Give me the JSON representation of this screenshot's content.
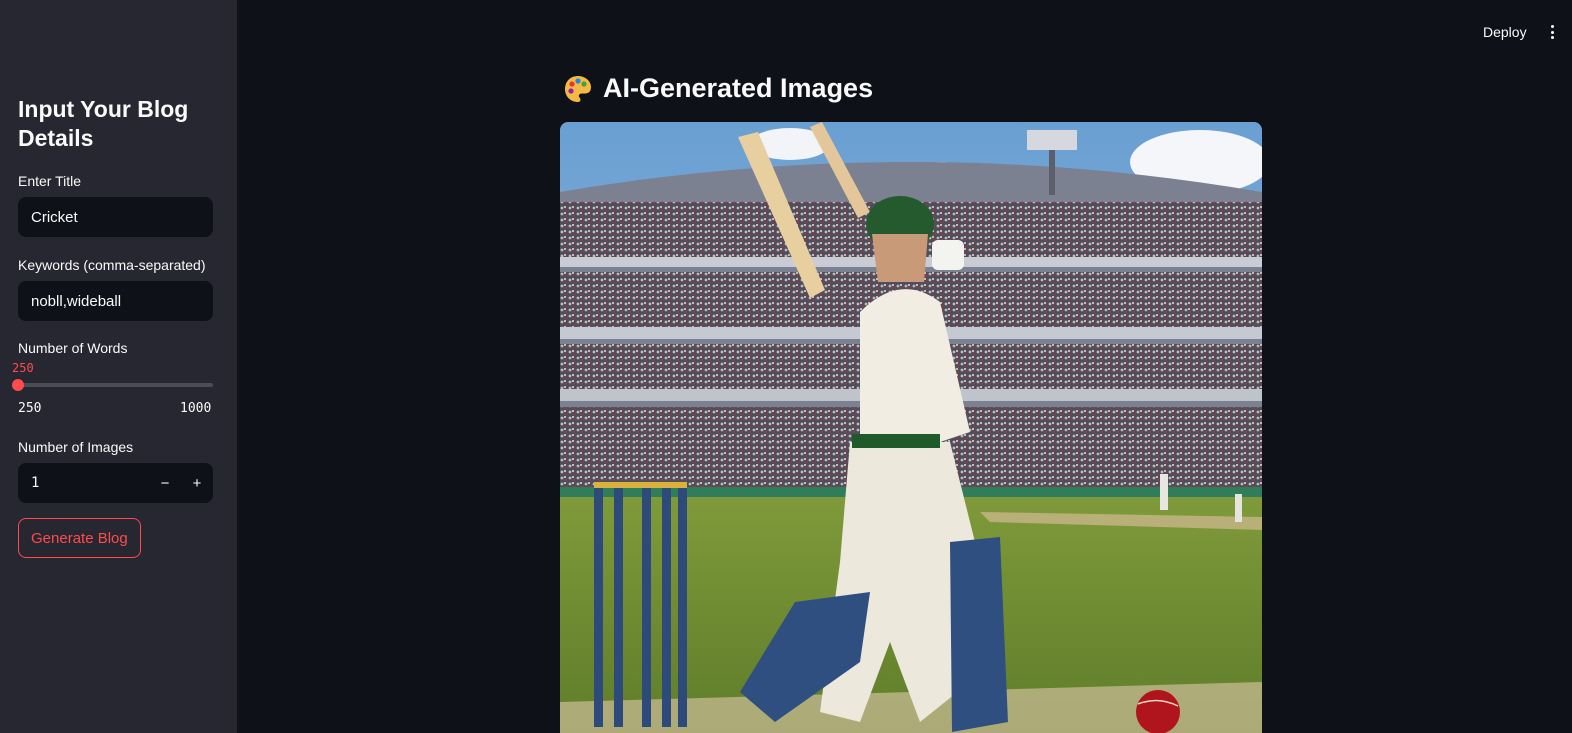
{
  "sidebar": {
    "title": "Input Your Blog Details",
    "title_input": {
      "label": "Enter Title",
      "value": "Cricket"
    },
    "keywords_input": {
      "label": "Keywords (comma-separated)",
      "value": "nobll,wideball"
    },
    "words_slider": {
      "label": "Number of Words",
      "value": "250",
      "min_label": "250",
      "max_label": "1000",
      "level_fraction": 0
    },
    "images_stepper": {
      "label": "Number of Images",
      "value": "1",
      "minus": "−",
      "plus": "+"
    },
    "generate_button": "Generate Blog"
  },
  "topbar": {
    "deploy_label": "Deploy",
    "menu_icon": "kebab-menu-icon"
  },
  "main": {
    "heading_icon": "artist-palette-icon",
    "heading": "AI-Generated Images",
    "image": {
      "subject": "cricket-batsman-image"
    }
  },
  "colors": {
    "accent": "#ff4b4b",
    "background": "#0e1117",
    "sidebar": "#262730"
  }
}
